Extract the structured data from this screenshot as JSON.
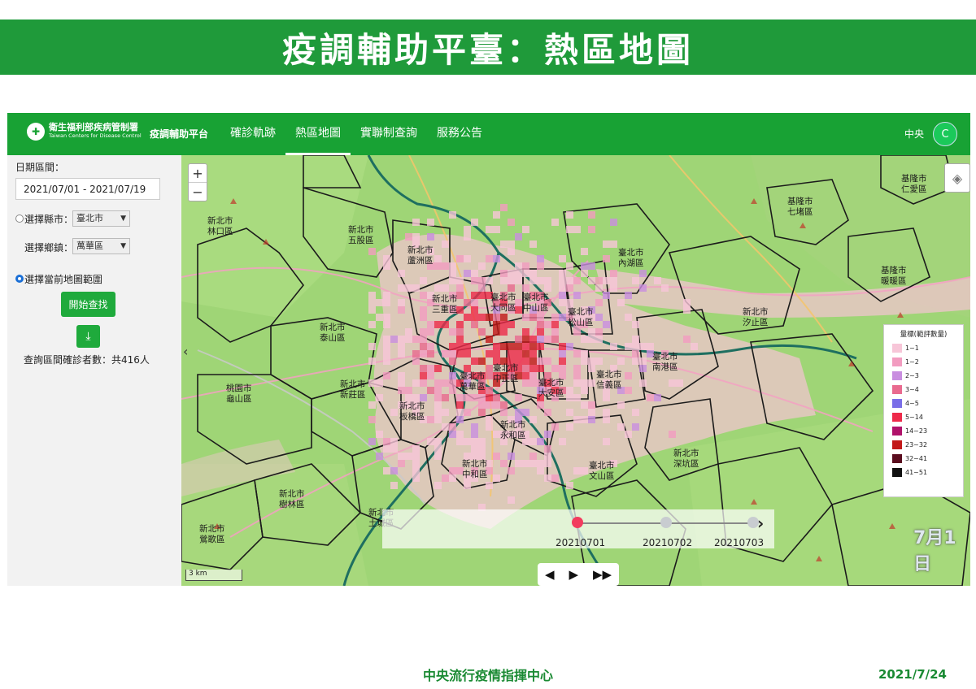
{
  "slide": {
    "title": "疫調輔助平臺：熱區地圖",
    "footer_org": "中央流行疫情指揮中心",
    "footer_date": "2021/7/24"
  },
  "navbar": {
    "logo_cn": "衛生福利部疾病管制署",
    "logo_en": "Taiwan Centers for Disease Control",
    "platform": "疫調輔助平台",
    "items": [
      {
        "label": "確診軌跡",
        "active": false
      },
      {
        "label": "熱區地圖",
        "active": true
      },
      {
        "label": "實聯制查詢",
        "active": false
      },
      {
        "label": "服務公告",
        "active": false
      }
    ],
    "user_label": "中央",
    "avatar_initial": "C"
  },
  "sidebar": {
    "date_range_label": "日期區間：",
    "date_range_value": "2021/07/01 - 2021/07/19",
    "city_label": "選擇縣市：",
    "city_value": "臺北市",
    "district_label": "選擇鄉鎮：",
    "district_value": "萬華區",
    "map_range_label": "選擇當前地圖範圍",
    "search_button": "開始查找",
    "download_icon": "download-icon",
    "result_text": "查詢區間確診者數：共416人"
  },
  "map": {
    "zoom_in": "+",
    "zoom_out": "−",
    "scale_label": "3 km",
    "districts": [
      {
        "city": "新北市",
        "name": "林口區"
      },
      {
        "city": "新北市",
        "name": "五股區"
      },
      {
        "city": "新北市",
        "name": "蘆洲區"
      },
      {
        "city": "新北市",
        "name": "三重區"
      },
      {
        "city": "新北市",
        "name": "泰山區"
      },
      {
        "city": "新北市",
        "name": "新莊區"
      },
      {
        "city": "桃園市",
        "name": "龜山區"
      },
      {
        "city": "新北市",
        "name": "板橋區"
      },
      {
        "city": "新北市",
        "name": "樹林區"
      },
      {
        "city": "新北市",
        "name": "鶯歌區"
      },
      {
        "city": "新北市",
        "name": "土城區"
      },
      {
        "city": "新北市",
        "name": "中和區"
      },
      {
        "city": "新北市",
        "name": "永和區"
      },
      {
        "city": "臺北市",
        "name": "大同區"
      },
      {
        "city": "臺北市",
        "name": "中山區"
      },
      {
        "city": "臺北市",
        "name": "萬華區"
      },
      {
        "city": "臺北市",
        "name": "中正區"
      },
      {
        "city": "臺北市",
        "name": "大安區"
      },
      {
        "city": "臺北市",
        "name": "信義區"
      },
      {
        "city": "臺北市",
        "name": "松山區"
      },
      {
        "city": "臺北市",
        "name": "內湖區"
      },
      {
        "city": "臺北市",
        "name": "南港區"
      },
      {
        "city": "臺北市",
        "name": "文山區"
      },
      {
        "city": "新北市",
        "name": "汐止區"
      },
      {
        "city": "新北市",
        "name": "深坑區"
      },
      {
        "city": "基隆市",
        "name": "七堵區"
      },
      {
        "city": "基隆市",
        "name": "暖暖區"
      },
      {
        "city": "基隆市",
        "name": "仁愛區"
      }
    ],
    "legend": {
      "title": "量標(範評數量)",
      "items": [
        {
          "label": "1~1",
          "color": "#f7c6d8"
        },
        {
          "label": "1~2",
          "color": "#f29cc0"
        },
        {
          "label": "2~3",
          "color": "#c98ee0"
        },
        {
          "label": "3~4",
          "color": "#e96a8f"
        },
        {
          "label": "4~5",
          "color": "#7a6ee8"
        },
        {
          "label": "5~14",
          "color": "#ee2a4a"
        },
        {
          "label": "14~23",
          "color": "#b0126a"
        },
        {
          "label": "23~32",
          "color": "#c21818"
        },
        {
          "label": "32~41",
          "color": "#5a0c1e"
        },
        {
          "label": "41~51",
          "color": "#111111"
        }
      ]
    },
    "timeline": {
      "dates": [
        "20210701",
        "20210702",
        "20210703"
      ],
      "active_index": 0
    },
    "day_label": "7月1日",
    "playback": {
      "prev": "◀",
      "play": "▶",
      "fast": "▶▶"
    }
  },
  "colors": {
    "brand_green": "#1f9a3a",
    "nav_green": "#18a234",
    "map_green": "#a8d97a",
    "hot_red": "#e6233f"
  }
}
